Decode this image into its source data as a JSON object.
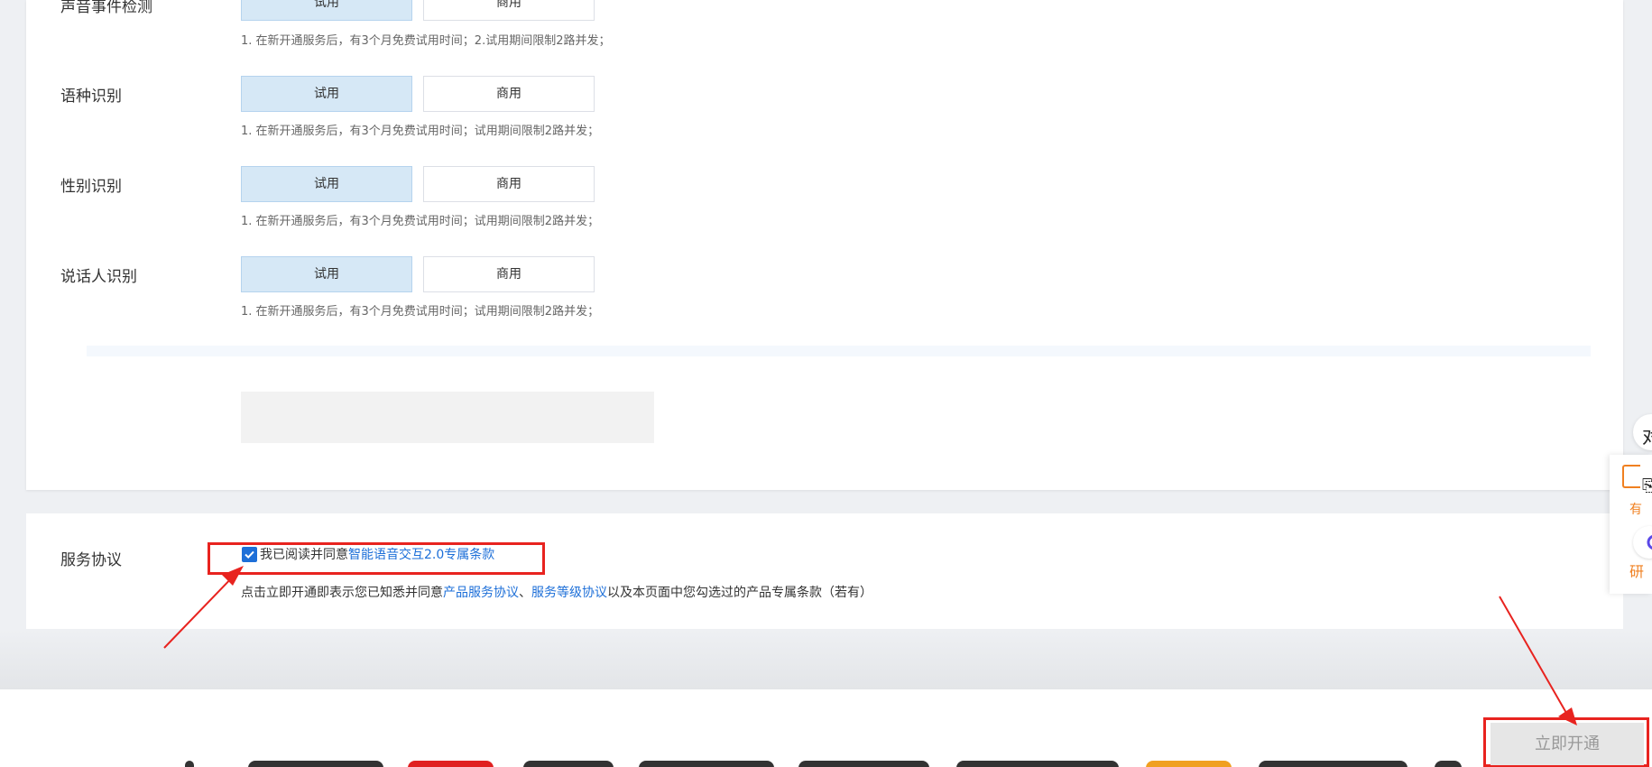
{
  "services": [
    {
      "label": "声音事件检测",
      "trial": "试用",
      "commercial": "商用",
      "note": "1. 在新开通服务后，有3个月免费试用时间；2.试用期间限制2路并发；"
    },
    {
      "label": "语种识别",
      "trial": "试用",
      "commercial": "商用",
      "note": "1. 在新开通服务后，有3个月免费试用时间；试用期间限制2路并发；"
    },
    {
      "label": "性别识别",
      "trial": "试用",
      "commercial": "商用",
      "note": "1. 在新开通服务后，有3个月免费试用时间；试用期间限制2路并发；"
    },
    {
      "label": "说话人识别",
      "trial": "试用",
      "commercial": "商用",
      "note": "1. 在新开通服务后，有3个月免费试用时间；试用期间限制2路并发；"
    }
  ],
  "agreement": {
    "label": "服务协议",
    "read_text": "我已阅读并同意",
    "terms_link": "智能语音交互2.0专属条款",
    "consent_prefix": "点击立即开通即表示您已知悉并同意",
    "product_link": "产品服务协议",
    "sep": "、",
    "sla_link": "服务等级协议",
    "consent_suffix": "以及本页面中您勾选过的产品专属条款（若有）"
  },
  "submit_label": "立即开通",
  "floating": {
    "top_glyph": "对",
    "doc_glyph": "⎘",
    "orange_1": "有",
    "orange_2": "研"
  },
  "colors": {
    "accent": "#1d6fd8",
    "highlight": "#e8231f",
    "selected_bg": "#d6e8f6"
  }
}
